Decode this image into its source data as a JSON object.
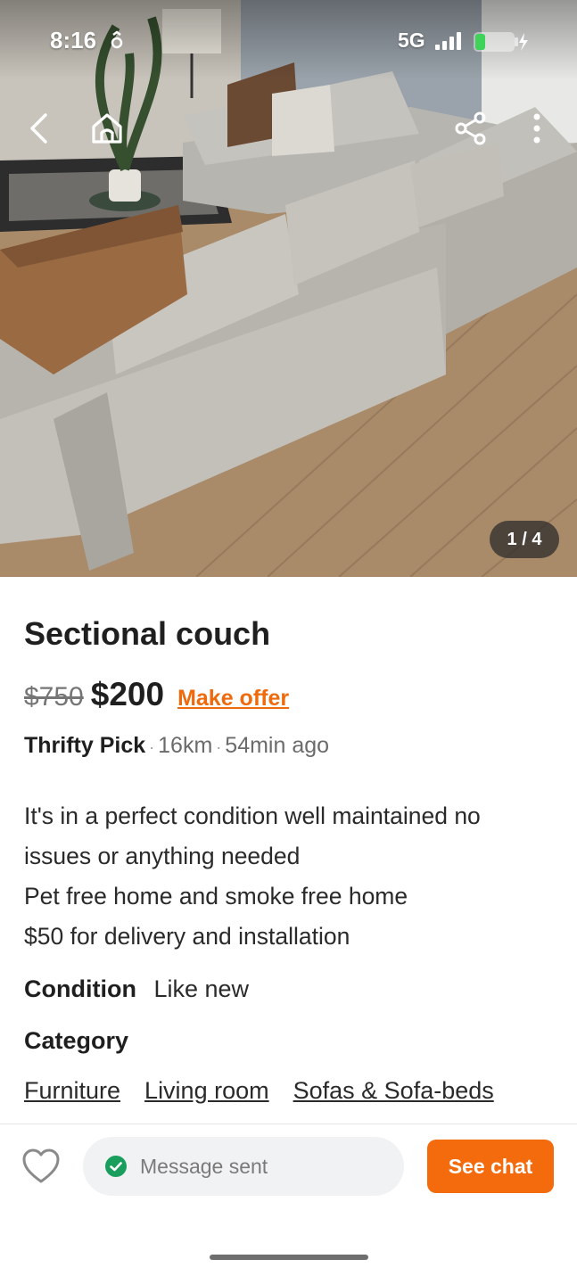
{
  "status_bar": {
    "time": "8:16",
    "network": "5G"
  },
  "photo": {
    "counter": "1 / 4"
  },
  "listing": {
    "title": "Sectional couch",
    "original_price": "$750",
    "price": "$200",
    "make_offer_label": "Make offer",
    "seller_name": "Thrifty Pick",
    "distance": "16km",
    "posted_ago": "54min ago",
    "description_lines": [
      "It's in a perfect condition well maintained no",
      "issues or anything needed",
      "Pet free home and smoke free home",
      "$50 for delivery and installation"
    ],
    "condition_label": "Condition",
    "condition_value": "Like new",
    "category_label": "Category",
    "categories": [
      "Furniture",
      "Living room",
      "Sofas & Sofa-beds"
    ]
  },
  "actions": {
    "message_status": "Message sent",
    "see_chat_label": "See chat"
  },
  "icons": {
    "back": "chevron-left-icon",
    "home": "home-icon",
    "share": "share-icon",
    "more": "more-vertical-icon",
    "favorite": "heart-icon",
    "message_status": "check-circle-icon"
  },
  "colors": {
    "accent": "#f46b0e",
    "make_offer": "#ee6a0c",
    "check": "#1a9e5e"
  }
}
